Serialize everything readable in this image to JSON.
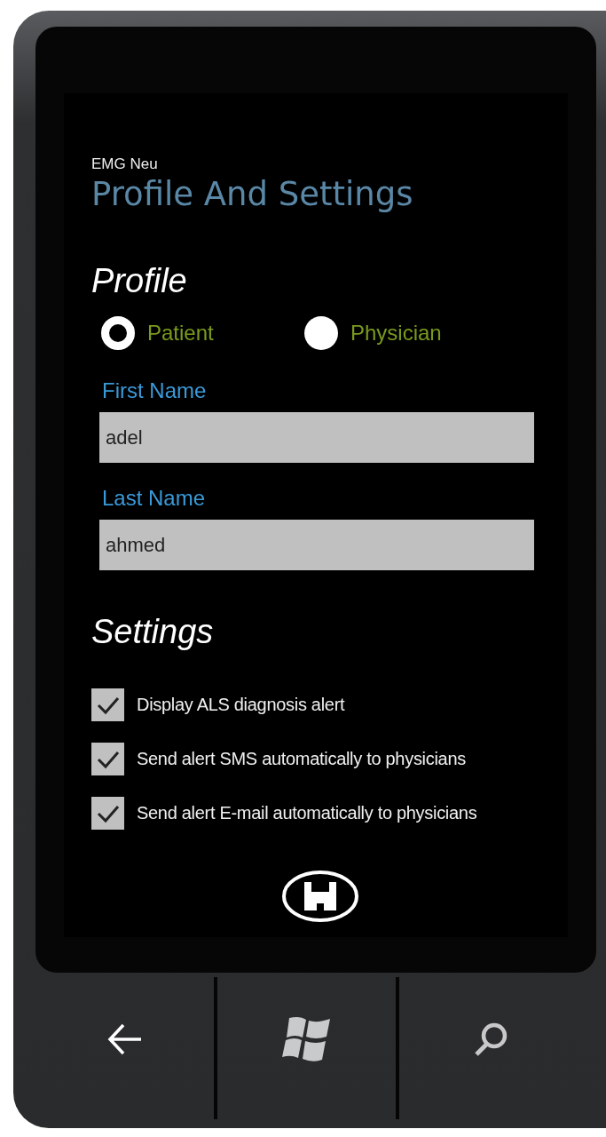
{
  "app_name": "EMG Neu",
  "page_title": "Profile And Settings",
  "profile": {
    "heading": "Profile",
    "roles": [
      {
        "label": "Patient",
        "selected": true
      },
      {
        "label": "Physician",
        "selected": false
      }
    ],
    "fields": [
      {
        "label": "First Name",
        "value": "adel"
      },
      {
        "label": "Last Name",
        "value": "ahmed"
      }
    ]
  },
  "settings": {
    "heading": "Settings",
    "options": [
      {
        "label": "Display ALS diagnosis alert",
        "checked": true
      },
      {
        "label": "Send alert SMS automatically to physicians",
        "checked": true
      },
      {
        "label": "Send alert E-mail automatically to physicians",
        "checked": true
      }
    ]
  }
}
